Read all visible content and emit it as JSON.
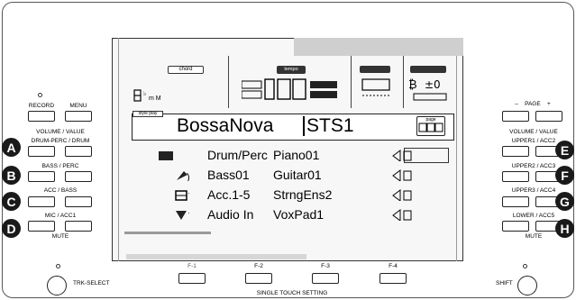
{
  "left_panel": {
    "record_label": "RECORD",
    "menu_label": "MENU",
    "volume_value_label": "VOLUME / VALUE",
    "drum_perc_label": "DRUM-PERC / DRUM",
    "bass_perc_label": "BASS / PERC",
    "acc_bass_label": "ACC / BASS",
    "mic_acc1_label": "MIC / ACC1",
    "mute_label": "MUTE",
    "letters": [
      "A",
      "B",
      "C",
      "D"
    ]
  },
  "right_panel": {
    "page_label": "PAGE",
    "page_minus": "–",
    "page_plus": "+",
    "volume_value_label": "VOLUME / VALUE",
    "upper1_label": "UPPER1 / ACC2",
    "upper2_label": "UPPER2 / ACC3",
    "upper3_label": "UPPER3 / ACC4",
    "lower_label": "LOWER / ACC5",
    "mute_label": "MUTE",
    "letters": [
      "E",
      "F",
      "G",
      "H"
    ]
  },
  "display": {
    "chord_tab": "chord",
    "tempo_tab": "tempo",
    "chord_sub": "m M",
    "style_tag": "style play",
    "style_name": "BossaNova",
    "performance_name": "STS1",
    "page_box": "page",
    "tracks": [
      {
        "left": "Drum/Perc",
        "right": "Piano01",
        "icon": "drum-icon"
      },
      {
        "left": "Bass01",
        "right": "Guitar01",
        "icon": "bass-icon"
      },
      {
        "left": "Acc.1-5",
        "right": "StrngEns2",
        "icon": "keyboard-icon"
      },
      {
        "left": "Audio In",
        "right": "VoxPad1",
        "icon": "mic-icon"
      }
    ]
  },
  "bottom": {
    "trk_select_label": "TRK-SELECT",
    "f1_label": "F-1",
    "f2_label": "F-2",
    "f3_label": "F-3",
    "f4_label": "F-4",
    "single_touch_label": "SINGLE TOUCH SETTING",
    "shift_label": "SHIFT"
  }
}
